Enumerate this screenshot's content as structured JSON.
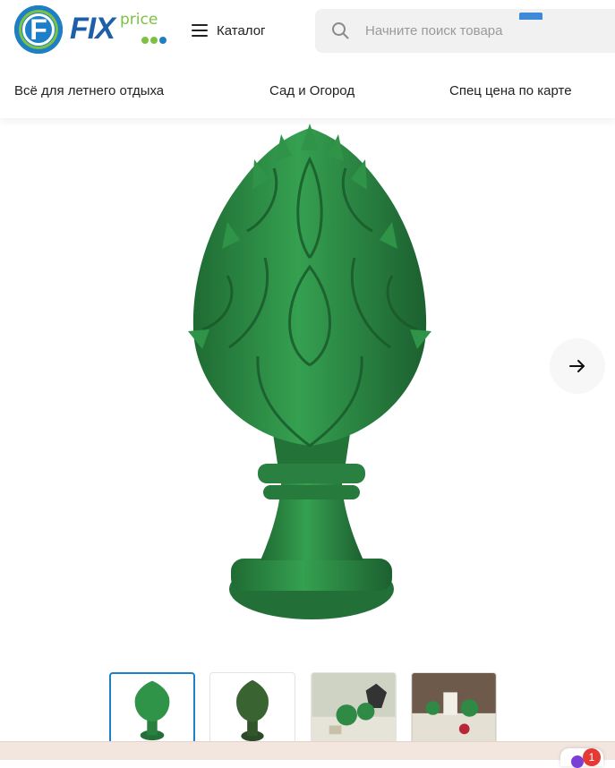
{
  "header": {
    "logo": {
      "letter": "F",
      "fix": "FIX",
      "price": "price"
    },
    "catalog_label": "Каталог",
    "search_placeholder": "Начните поиск товара"
  },
  "nav": {
    "items": [
      {
        "label": "Всё для летнего отдыха"
      },
      {
        "label": "Сад и Огород"
      },
      {
        "label": "Спец цена по карте"
      }
    ]
  },
  "product": {
    "thumbnails": [
      {
        "kind": "green-vase"
      },
      {
        "kind": "dark-vase"
      },
      {
        "kind": "interior-1"
      },
      {
        "kind": "interior-2"
      }
    ],
    "active_thumbnail": 0
  },
  "chat": {
    "badge": "1"
  },
  "colors": {
    "brand_blue": "#1d7fc7",
    "brand_green": "#7cc242",
    "vase_green": "#2f8a45"
  },
  "icons": [
    "menu-icon",
    "search-icon",
    "arrow-right-icon",
    "chat-icon"
  ]
}
